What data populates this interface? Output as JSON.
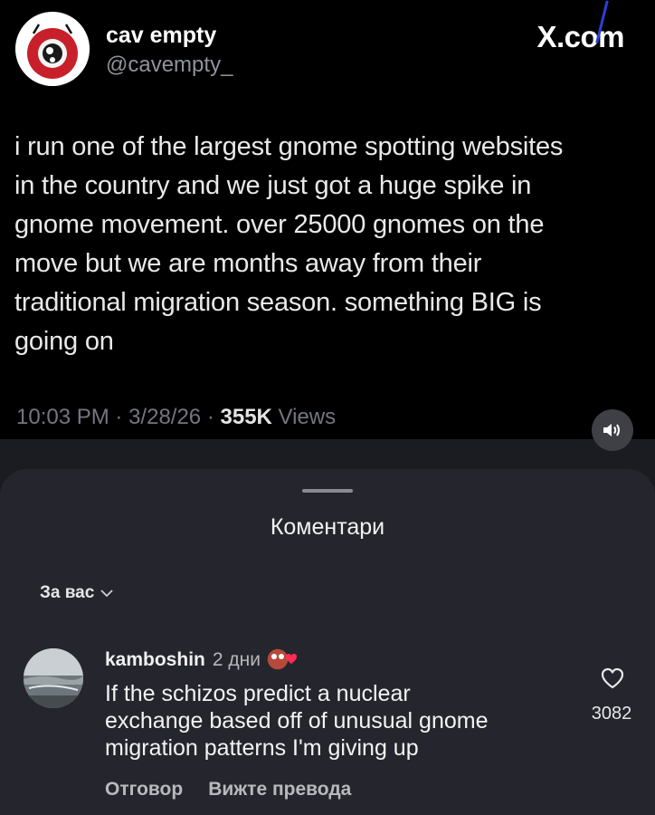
{
  "tweet": {
    "display_name": "cav empty",
    "handle": "@cavempty_",
    "brand": "X.com",
    "text": "i run one of the largest gnome spotting websites\nin the country and we just got a huge spike in\ngnome movement. over 25000 gnomes on the\nmove but we are months away from their\ntraditional migration season. something BIG is\ngoing on",
    "time": "10:03 PM",
    "date": "3/28/26",
    "views_count": "355K",
    "views_label": "Views",
    "separator": "·",
    "avatar_icon": "camera-lens-avatar-icon",
    "sound_icon": "speaker-icon"
  },
  "comments_sheet": {
    "title": "Коментари",
    "sort_label": "За вас",
    "sort_icon": "chevron-down-icon"
  },
  "comment": {
    "username": "kamboshin",
    "age": "2 дни",
    "text": "If the schizos predict a nuclear\nexchange based off of unusual gnome\nmigration patterns I'm giving up",
    "like_count": "3082",
    "reply_label": "Отговор",
    "translate_label": "Вижте превода",
    "like_icon": "heart-outline-icon",
    "creator_like_icon": "creator-liked-heart-icon"
  },
  "colors": {
    "tweet_bg": "#000000",
    "sheet_bg": "#25262d",
    "heart_red": "#ff2d55"
  }
}
